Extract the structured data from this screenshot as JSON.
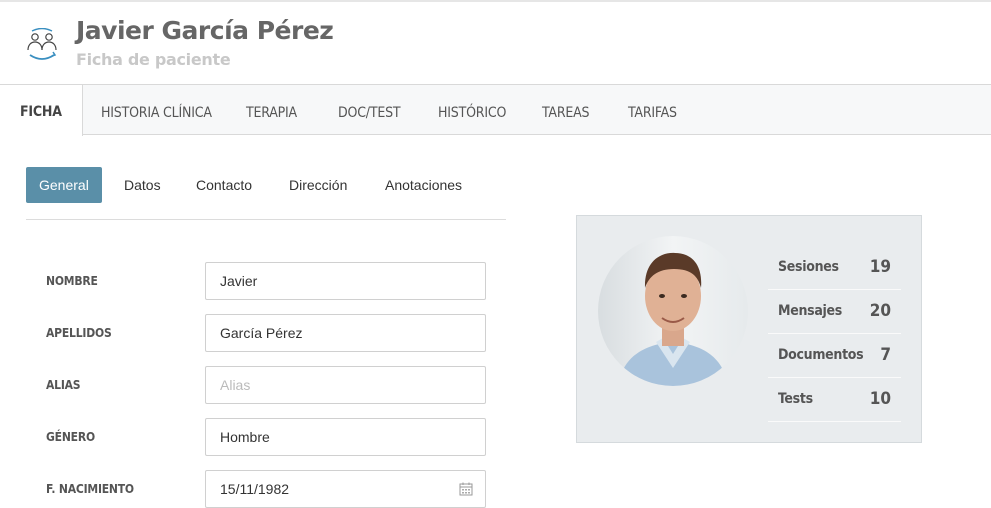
{
  "header": {
    "logo_icon": "patients-icon",
    "title": "Javier García Pérez",
    "subtitle": "Ficha de paciente"
  },
  "tabs": [
    {
      "label": "FICHA",
      "active": true
    },
    {
      "label": "HISTORIA CLÍNICA"
    },
    {
      "label": "TERAPIA"
    },
    {
      "label": "DOC/TEST"
    },
    {
      "label": "HISTÓRICO"
    },
    {
      "label": "TAREAS"
    },
    {
      "label": "TARIFAS"
    }
  ],
  "subtabs": [
    {
      "label": "General",
      "active": true
    },
    {
      "label": "Datos"
    },
    {
      "label": "Contacto"
    },
    {
      "label": "Dirección"
    },
    {
      "label": "Anotaciones"
    }
  ],
  "form": {
    "nombre": {
      "label": "NOMBRE",
      "value": "Javier"
    },
    "apellidos": {
      "label": "APELLIDOS",
      "value": "García Pérez"
    },
    "alias": {
      "label": "ALIAS",
      "value": "",
      "placeholder": "Alias"
    },
    "genero": {
      "label": "GÉNERO",
      "value": "Hombre"
    },
    "nacimiento": {
      "label": "F. NACIMIENTO",
      "value": "15/11/1982",
      "icon": "calendar-icon"
    }
  },
  "stats": [
    {
      "label": "Sesiones",
      "value": "19"
    },
    {
      "label": "Mensajes",
      "value": "20"
    },
    {
      "label": "Documentos",
      "value": "7"
    },
    {
      "label": "Tests",
      "value": "10"
    }
  ],
  "colors": {
    "accent": "#5a8fa8",
    "logo": "#3a8fc0"
  }
}
